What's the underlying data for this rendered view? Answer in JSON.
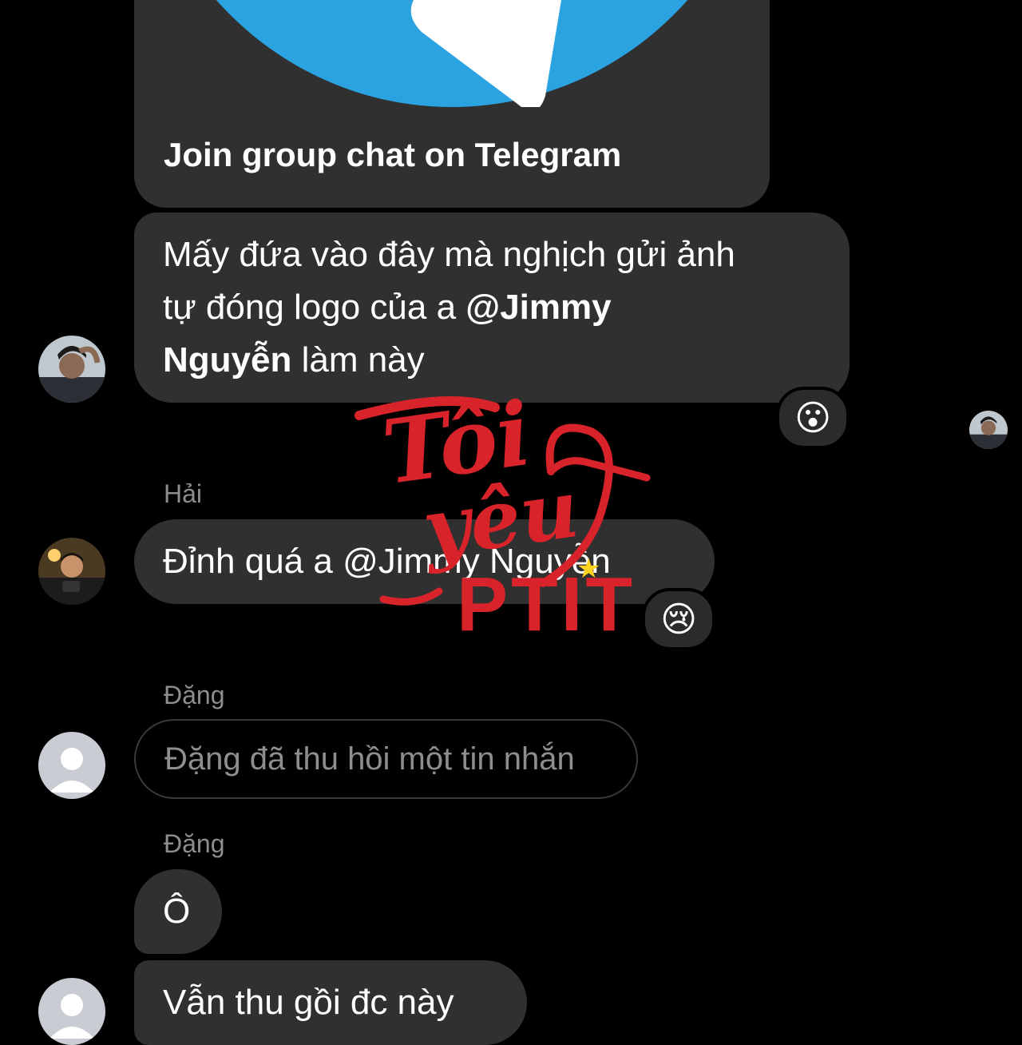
{
  "link_card": {
    "title": "Join group chat on Telegram",
    "accent": "#2aa3e0"
  },
  "messages": [
    {
      "id": "m1",
      "text_1": "Mấy đứa vào đây mà nghịch gửi ảnh",
      "text_2a": "tự đóng logo của a ",
      "mention_1": "@Jimmy",
      "mention_2": "Nguyễn",
      "text_3": " làm này",
      "reaction": "😮"
    },
    {
      "id": "m2",
      "sender": "Hải",
      "text_pre": "Đỉnh quá a ",
      "mention": "@Jimmy Nguyễn",
      "reaction": "😢"
    },
    {
      "id": "m3",
      "sender": "Đặng",
      "unsent_text": "Đặng đã thu hồi một tin nhắn"
    },
    {
      "id": "m4",
      "sender": "Đặng",
      "text": "Ô"
    },
    {
      "id": "m5",
      "text": "Vẫn thu gồi đc này"
    }
  ],
  "watermark": {
    "line1": "Tôi",
    "line2": "yêu",
    "line3": "PTIT",
    "color": "#d8232a"
  },
  "icons": {
    "telegram": "telegram-plane-icon",
    "avatar_placeholder": "person-silhouette-icon"
  }
}
